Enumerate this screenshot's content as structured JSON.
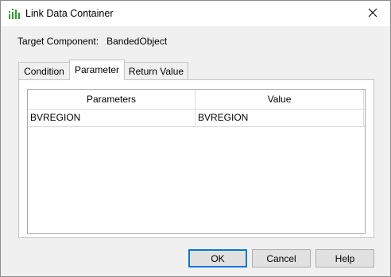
{
  "window": {
    "title": "Link Data Container",
    "close_icon": "close-icon",
    "app_icon": "chart-bars-icon"
  },
  "target": {
    "label": "Target Component:",
    "value": "BandedObject"
  },
  "tabs": [
    {
      "label": "Condition"
    },
    {
      "label": "Parameter",
      "active": true
    },
    {
      "label": "Return Value"
    }
  ],
  "grid": {
    "columns": [
      "Parameters",
      "Value"
    ],
    "rows": [
      {
        "parameter": "BVREGION",
        "value": "BVREGION"
      }
    ]
  },
  "buttons": {
    "ok": "OK",
    "cancel": "Cancel",
    "help": "Help"
  },
  "colors": {
    "accent": "#0078d7",
    "icon_green": "#2ca02c"
  }
}
